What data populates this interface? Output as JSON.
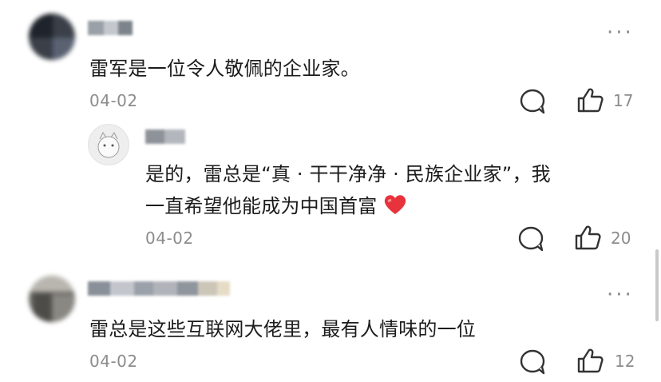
{
  "comments": [
    {
      "text": "雷军是一位令人敬佩的企业家。",
      "date": "04-02",
      "likes": "17",
      "more": "···",
      "icons": {
        "reply": "reply-bubble-icon",
        "like": "thumbs-up-icon"
      }
    },
    {
      "text_line1": "是的，雷总是“真 · 干干净净 · 民族企业家”，我",
      "text_line2": "一直希望他能成为中国首富",
      "emoji": "heart-emoji",
      "date": "04-02",
      "likes": "20",
      "icons": {
        "reply": "reply-bubble-icon",
        "like": "thumbs-up-icon"
      }
    },
    {
      "text": "雷总是这些互联网大佬里，最有人情味的一位",
      "date": "04-02",
      "likes": "12",
      "more": "···",
      "icons": {
        "reply": "reply-bubble-icon",
        "like": "thumbs-up-icon"
      }
    }
  ],
  "colors": {
    "text": "#1c1c1c",
    "meta": "#8c8c8c",
    "heart": "#e8323c",
    "icon": "#333333"
  }
}
